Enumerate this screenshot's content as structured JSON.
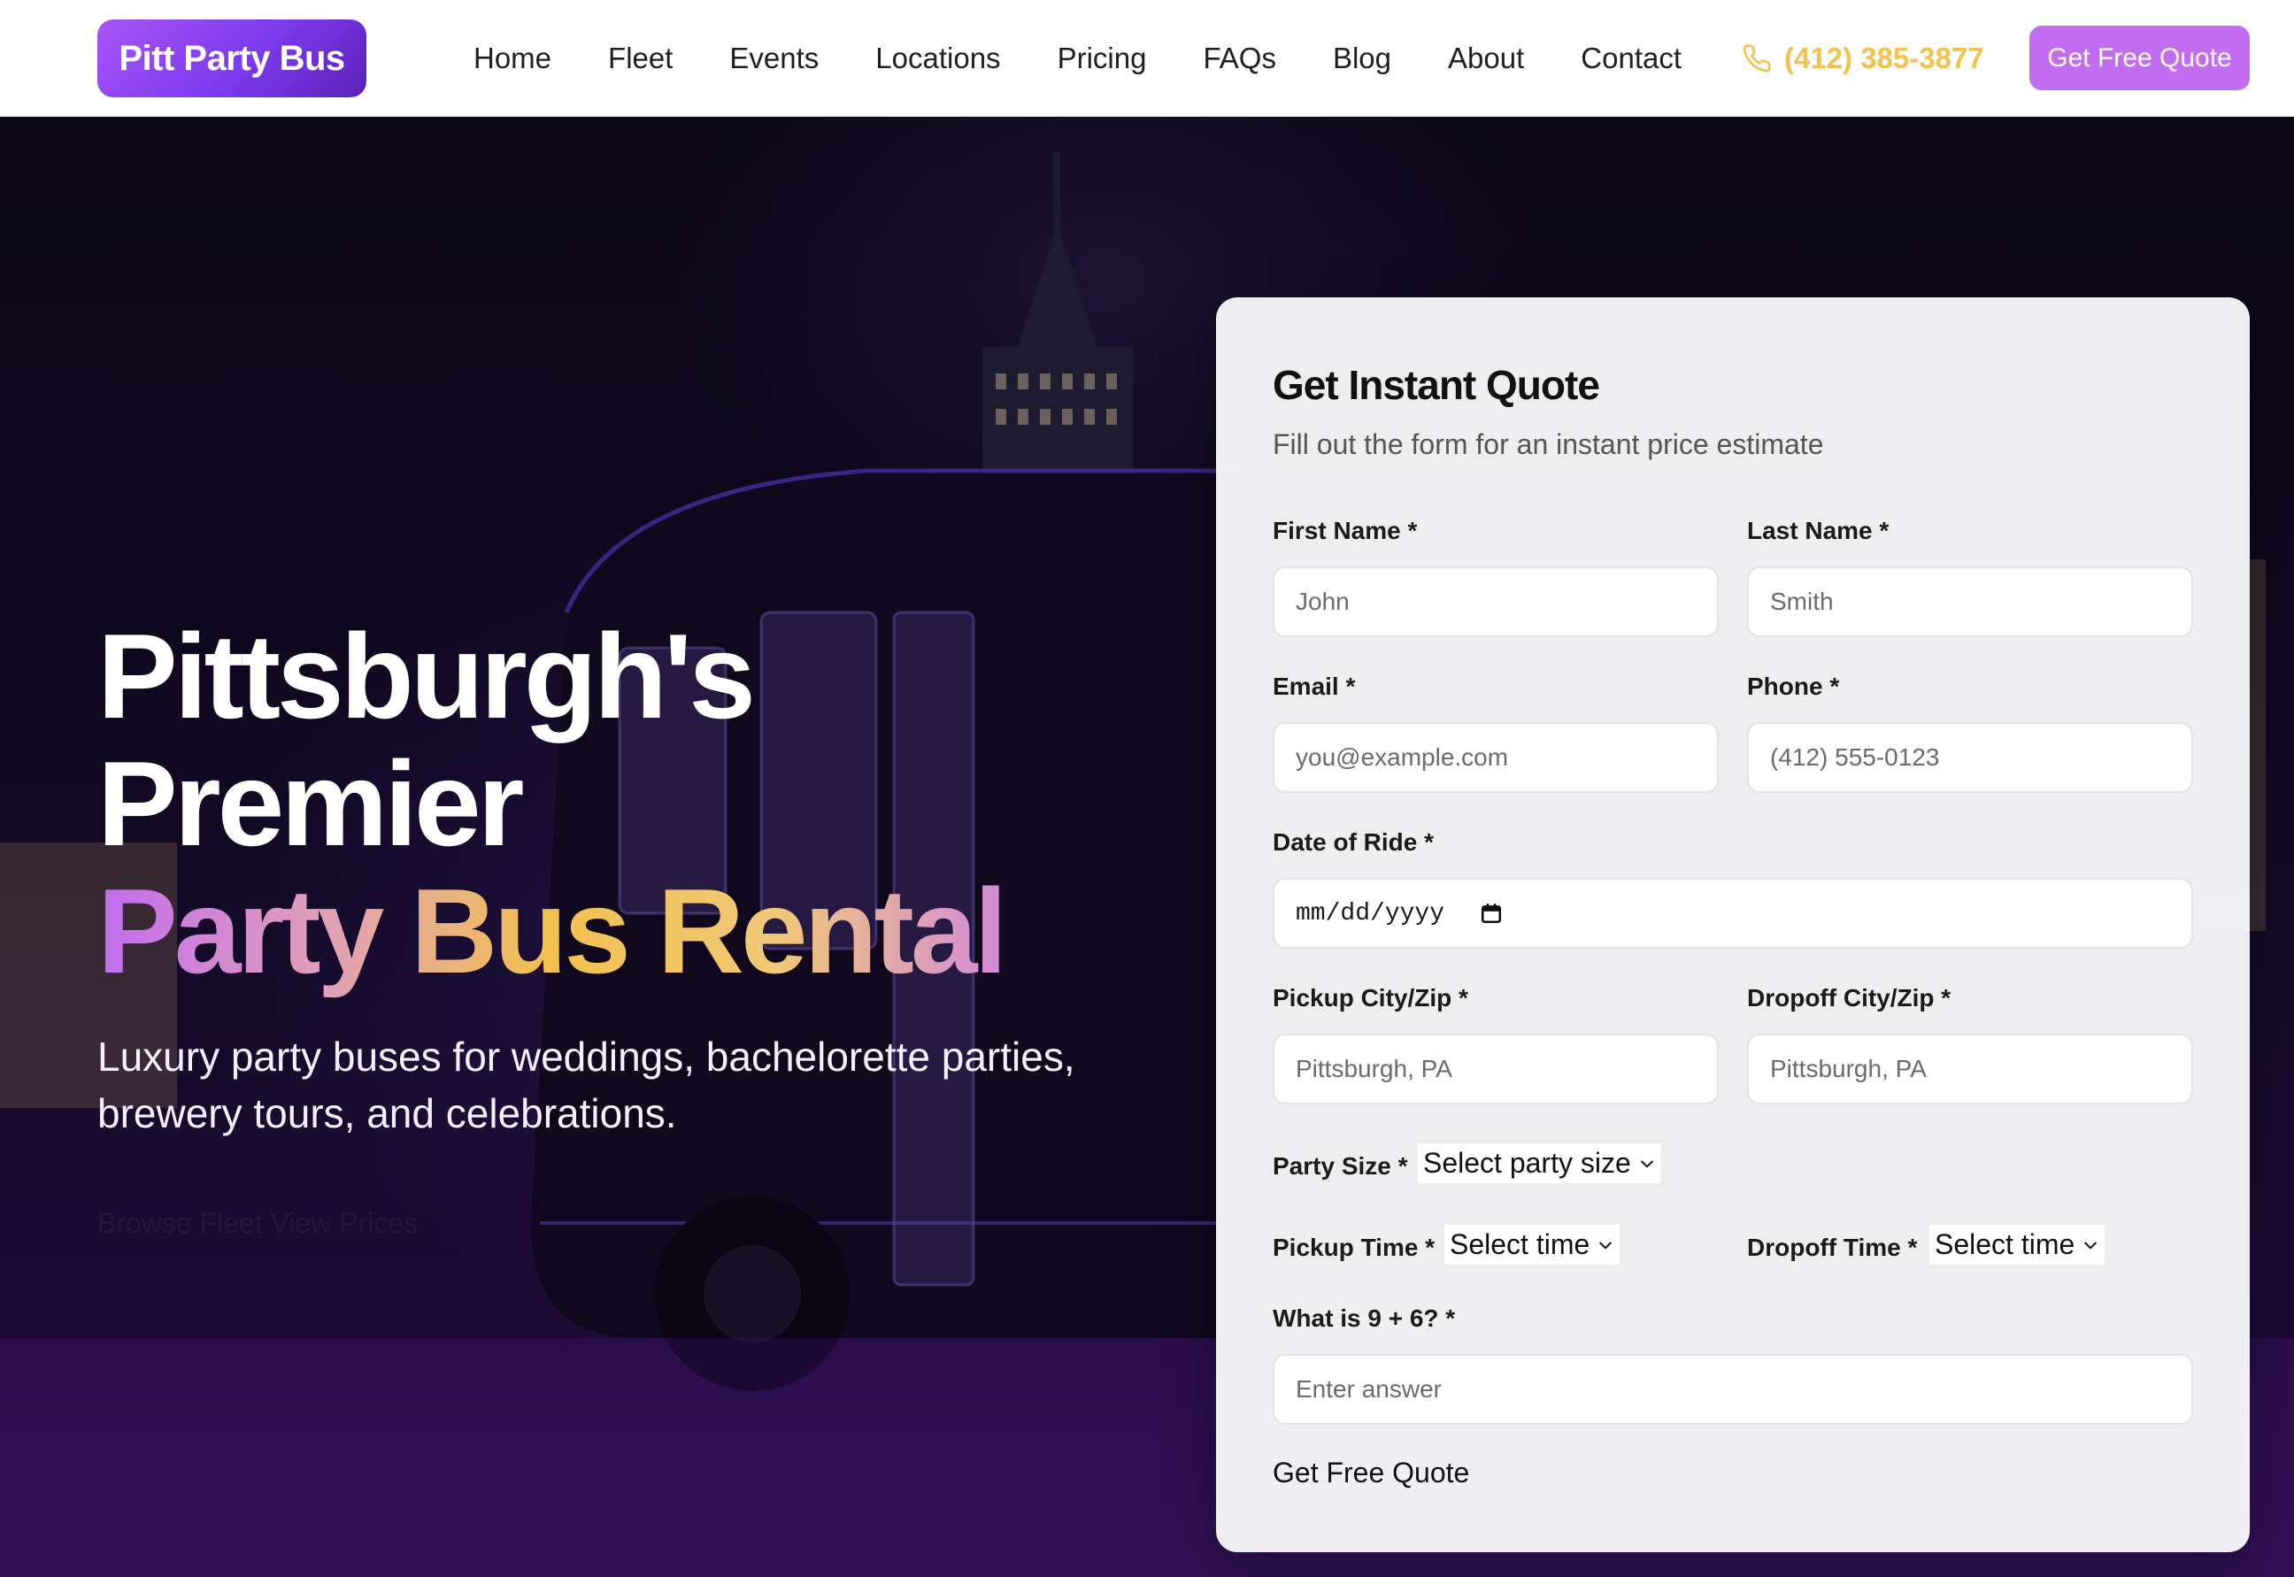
{
  "header": {
    "logo": "Pitt Party Bus",
    "nav": [
      "Home",
      "Fleet",
      "Events",
      "Locations",
      "Pricing",
      "FAQs",
      "Blog",
      "About",
      "Contact"
    ],
    "phone": "(412) 385-3877",
    "cta": "Get Free Quote"
  },
  "hero": {
    "title_line1": "Pittsburgh's",
    "title_line2": "Premier",
    "title_accent": "Party Bus Rental",
    "subtitle": "Luxury party buses for weddings, bachelorette parties, brewery tours, and celebrations.",
    "links_text": "Browse Fleet   View Prices"
  },
  "form": {
    "title": "Get Instant Quote",
    "subtitle": "Fill out the form for an instant price estimate",
    "first_name": {
      "label": "First Name *",
      "placeholder": "John"
    },
    "last_name": {
      "label": "Last Name *",
      "placeholder": "Smith"
    },
    "email": {
      "label": "Email *",
      "placeholder": "you@example.com"
    },
    "phone": {
      "label": "Phone *",
      "placeholder": "(412) 555-0123"
    },
    "date": {
      "label": "Date of Ride *",
      "value": "mm/dd/yyyy"
    },
    "pickup_city": {
      "label": "Pickup City/Zip *",
      "placeholder": "Pittsburgh, PA"
    },
    "dropoff_city": {
      "label": "Dropoff City/Zip *",
      "placeholder": "Pittsburgh, PA"
    },
    "party_size": {
      "label": "Party Size *",
      "value": "Select party size"
    },
    "pickup_time": {
      "label": "Pickup Time *",
      "value": "Select time"
    },
    "dropoff_time": {
      "label": "Dropoff Time *",
      "value": "Select time"
    },
    "captcha": {
      "label": "What is 9 + 6? *",
      "placeholder": "Enter answer"
    },
    "submit": "Get Free Quote"
  },
  "colors": {
    "brand_purple": "#a855f7",
    "accent_gold": "#f2c14e",
    "cta_bg": "#c26cf0"
  }
}
